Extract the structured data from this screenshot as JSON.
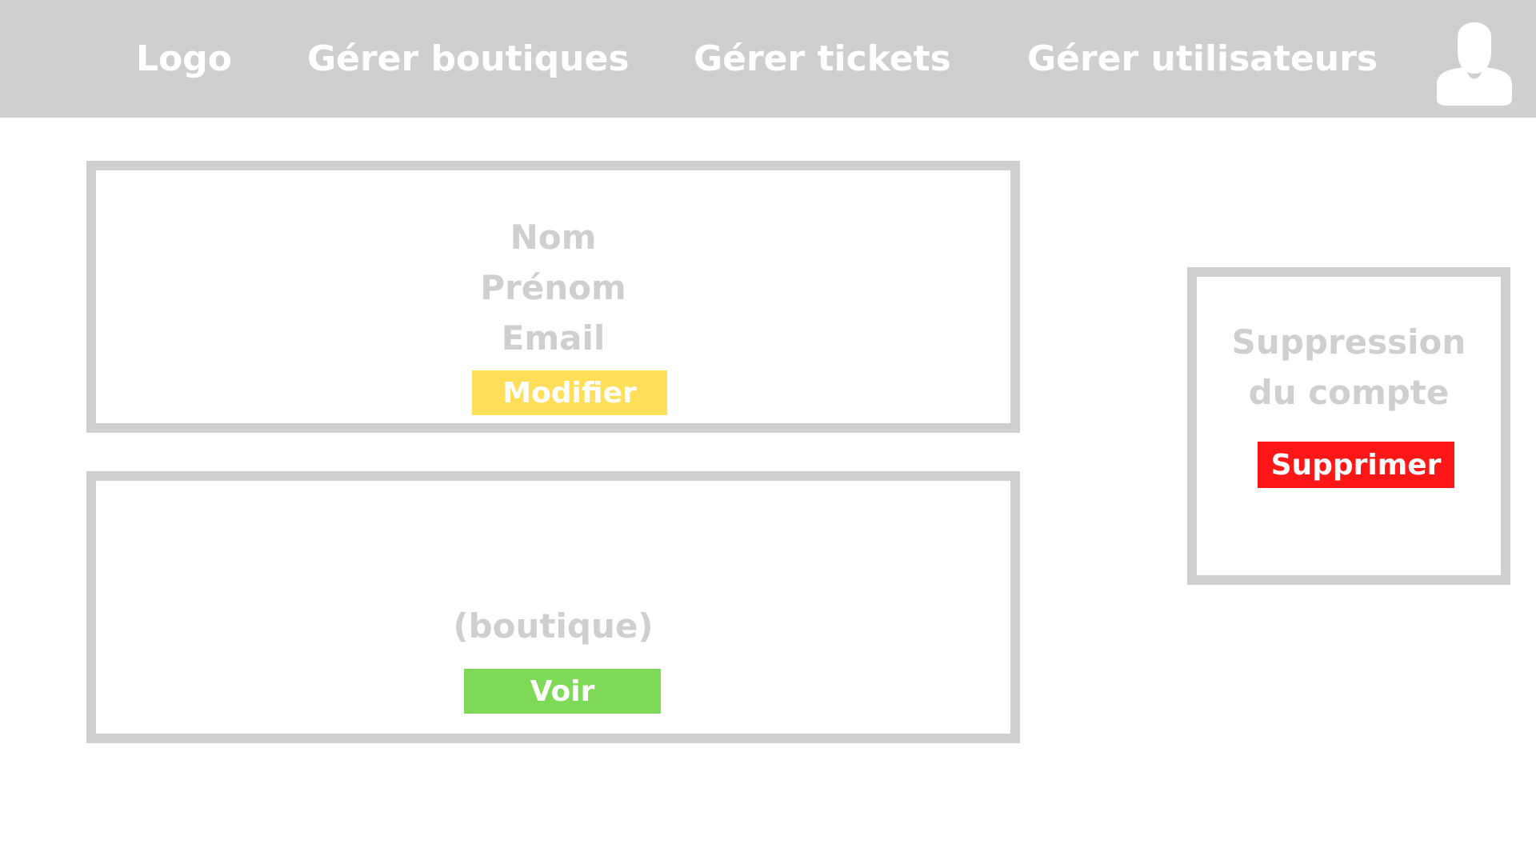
{
  "nav": {
    "logo": "Logo",
    "items": [
      "Gérer boutiques",
      "Gérer tickets",
      "Gérer utilisateurs"
    ],
    "avatar_icon": "user-avatar-icon"
  },
  "profile": {
    "fields": [
      "Nom",
      "Prénom",
      "Email"
    ],
    "modify_label": "Modifier"
  },
  "shop": {
    "text": "(boutique)",
    "view_label": "Voir"
  },
  "deletion": {
    "title": "Suppression du compte",
    "delete_label": "Supprimer"
  },
  "colors": {
    "topbar": "#cfcfcf",
    "border": "#cfcfcf",
    "modify": "#ffde59",
    "view": "#7ed957",
    "delete": "#ff1616"
  }
}
